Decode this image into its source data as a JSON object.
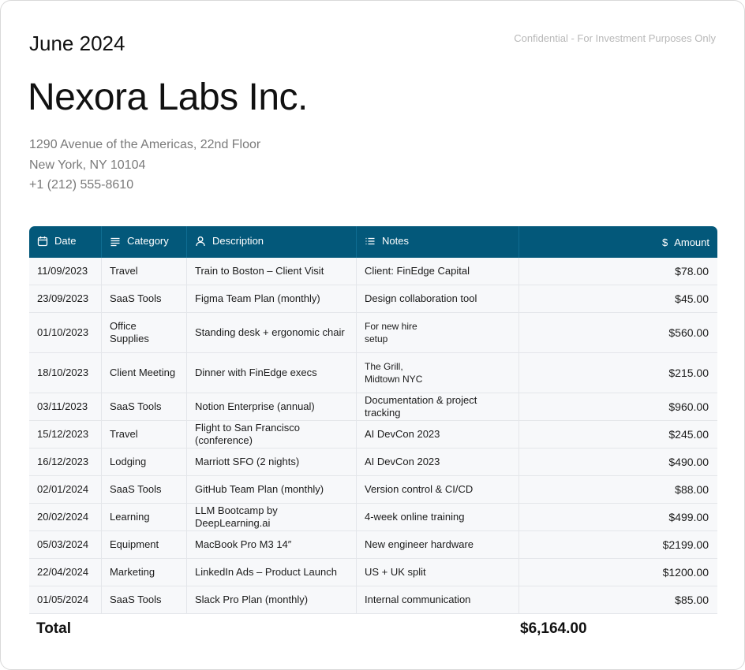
{
  "header": {
    "period": "June 2024",
    "confidential": "Confidential - For Investment Purposes Only",
    "company": "Nexora Labs Inc.",
    "address": {
      "line1": "1290 Avenue of the Americas, 22nd Floor",
      "line2": "New York, NY 10104",
      "phone": "+1 (212) 555-8610"
    }
  },
  "table": {
    "header_color": "#03587a",
    "columns": [
      {
        "label": "Date",
        "icon": "calendar-icon"
      },
      {
        "label": "Category",
        "icon": "lines-icon"
      },
      {
        "label": "Description",
        "icon": "person-icon"
      },
      {
        "label": "Notes",
        "icon": "list-icon"
      },
      {
        "label": "Amount",
        "icon": "dollar-sign"
      }
    ],
    "amount_symbol": "$",
    "rows": [
      {
        "date": "11/09/2023",
        "category": "Travel",
        "description": "Train to Boston – Client Visit",
        "notes": [
          "Client: FinEdge Capital"
        ],
        "amount": "$78.00"
      },
      {
        "date": "23/09/2023",
        "category": "SaaS Tools",
        "description": "Figma Team Plan (monthly)",
        "notes": [
          "Design collaboration tool"
        ],
        "amount": "$45.00"
      },
      {
        "date": "01/10/2023",
        "category": "Office Supplies",
        "description": "Standing desk + ergonomic chair",
        "notes": [
          "For new hire",
          "setup"
        ],
        "amount": "$560.00"
      },
      {
        "date": "18/10/2023",
        "category": "Client Meeting",
        "description": "Dinner with FinEdge execs",
        "notes": [
          "The Grill,",
          "Midtown NYC"
        ],
        "amount": "$215.00"
      },
      {
        "date": "03/11/2023",
        "category": "SaaS Tools",
        "description": "Notion Enterprise (annual)",
        "notes": [
          "Documentation & project tracking"
        ],
        "amount": "$960.00"
      },
      {
        "date": "15/12/2023",
        "category": "Travel",
        "description": "Flight to San Francisco (conference)",
        "notes": [
          "AI DevCon 2023"
        ],
        "amount": "$245.00"
      },
      {
        "date": "16/12/2023",
        "category": "Lodging",
        "description": "Marriott SFO (2 nights)",
        "notes": [
          "AI DevCon 2023"
        ],
        "amount": "$490.00"
      },
      {
        "date": "02/01/2024",
        "category": "SaaS Tools",
        "description": "GitHub Team Plan (monthly)",
        "notes": [
          "Version control & CI/CD"
        ],
        "amount": "$88.00"
      },
      {
        "date": "20/02/2024",
        "category": "Learning",
        "description": "LLM Bootcamp by DeepLearning.ai",
        "notes": [
          "4-week online training"
        ],
        "amount": "$499.00"
      },
      {
        "date": "05/03/2024",
        "category": "Equipment",
        "description": "MacBook Pro M3 14″",
        "notes": [
          "New engineer hardware"
        ],
        "amount": "$2199.00"
      },
      {
        "date": "22/04/2024",
        "category": "Marketing",
        "description": "LinkedIn Ads – Product Launch",
        "notes": [
          "US + UK split"
        ],
        "amount": "$1200.00"
      },
      {
        "date": "01/05/2024",
        "category": "SaaS Tools",
        "description": "Slack Pro Plan (monthly)",
        "notes": [
          "Internal communication"
        ],
        "amount": "$85.00"
      }
    ]
  },
  "total": {
    "label": "Total",
    "value": "$6,164.00"
  }
}
